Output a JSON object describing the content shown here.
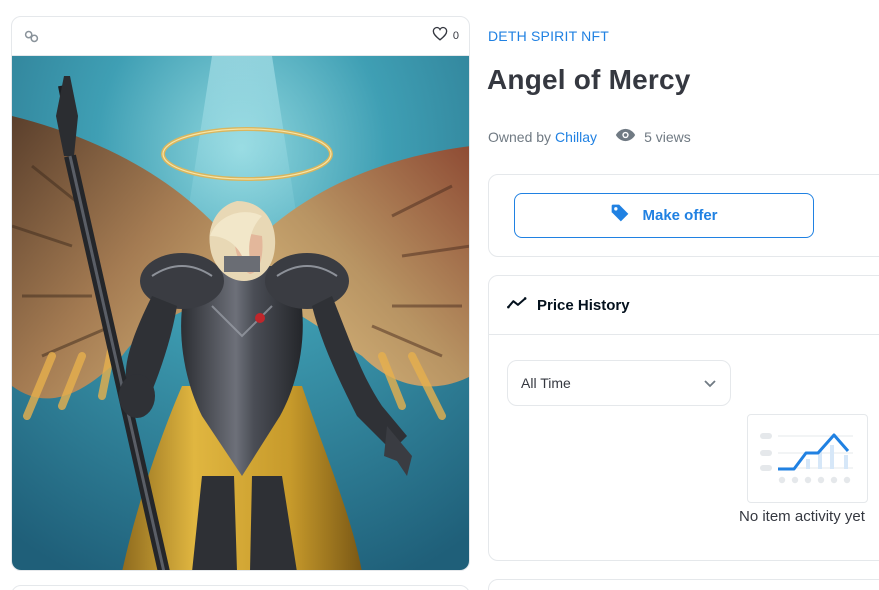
{
  "asset": {
    "favorite_count": "0",
    "image_alt": "Angel of Mercy"
  },
  "collection": {
    "name": "DETH SPIRIT NFT"
  },
  "item": {
    "title": "Angel of Mercy",
    "owned_by_label": "Owned by",
    "owner": "Chillay",
    "views": "5 views"
  },
  "actions": {
    "make_offer_label": "Make offer"
  },
  "price_history": {
    "title": "Price History",
    "range_selected": "All Time",
    "empty_text": "No item activity yet"
  },
  "colors": {
    "accent": "#2081e2",
    "text": "#353840",
    "muted": "#707a83",
    "border": "#e5e8eb"
  },
  "icons": {
    "chain": "link-icon",
    "favorite": "heart-icon",
    "views": "eye-icon",
    "offer": "tag-icon",
    "history": "trend-line-icon",
    "dropdown": "chevron-down-icon"
  }
}
